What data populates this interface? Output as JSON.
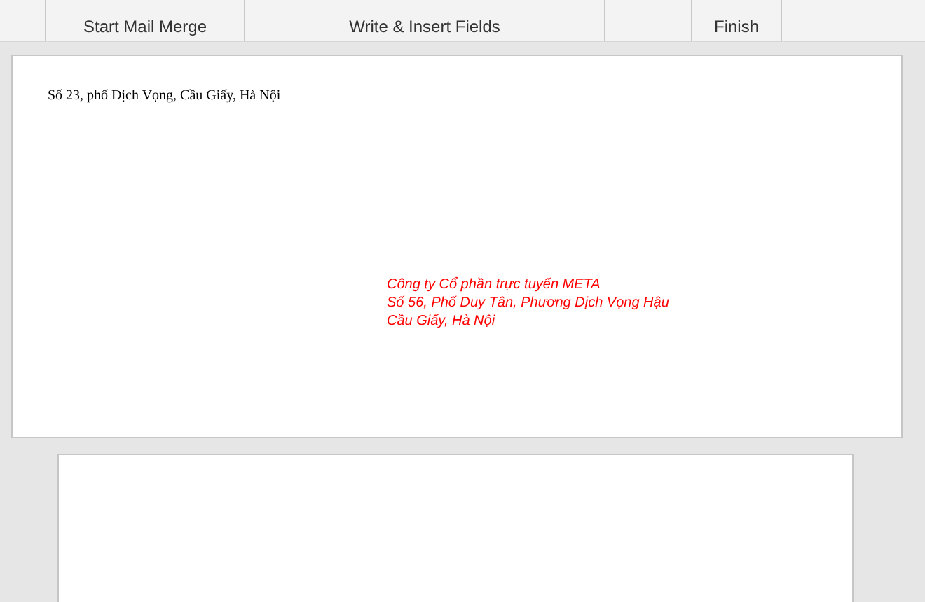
{
  "ribbon": {
    "groups": [
      {
        "label": "Start Mail Merge"
      },
      {
        "label": "Write & Insert Fields"
      },
      {
        "label": "Finish"
      }
    ]
  },
  "envelope": {
    "return_address": "Số 23, phố Dịch Vọng, Cầu Giấy, Hà Nội",
    "delivery_address": [
      "Công ty Cổ phần trực tuyến META",
      "Số 56, Phố Duy Tân, Phương Dịch Vọng Hậu",
      "Cầu Giấy, Hà Nội"
    ]
  }
}
